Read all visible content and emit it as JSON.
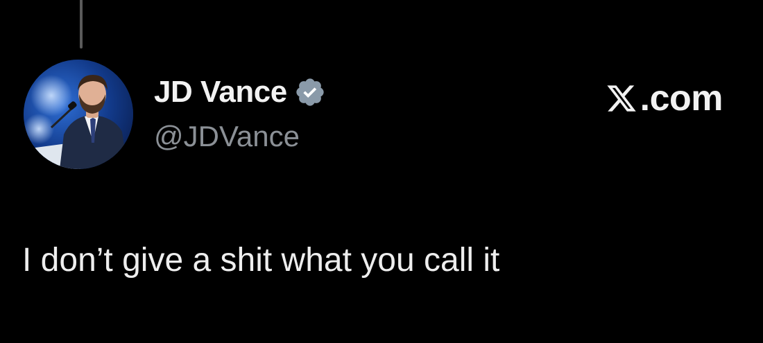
{
  "tweet": {
    "author": {
      "display_name": "JD Vance",
      "handle": "@JDVance",
      "verified": true,
      "avatar_icon": "profile-photo"
    },
    "brand": {
      "logo_icon": "x-logo-icon",
      "suffix": ".com"
    },
    "text": "I don’t give a shit what you call it"
  },
  "colors": {
    "background": "#000000",
    "text_primary": "#eeeeee",
    "text_secondary": "#8b9096",
    "verified_badge": "#8a9aa9",
    "thread_line": "#5a5a5a"
  }
}
